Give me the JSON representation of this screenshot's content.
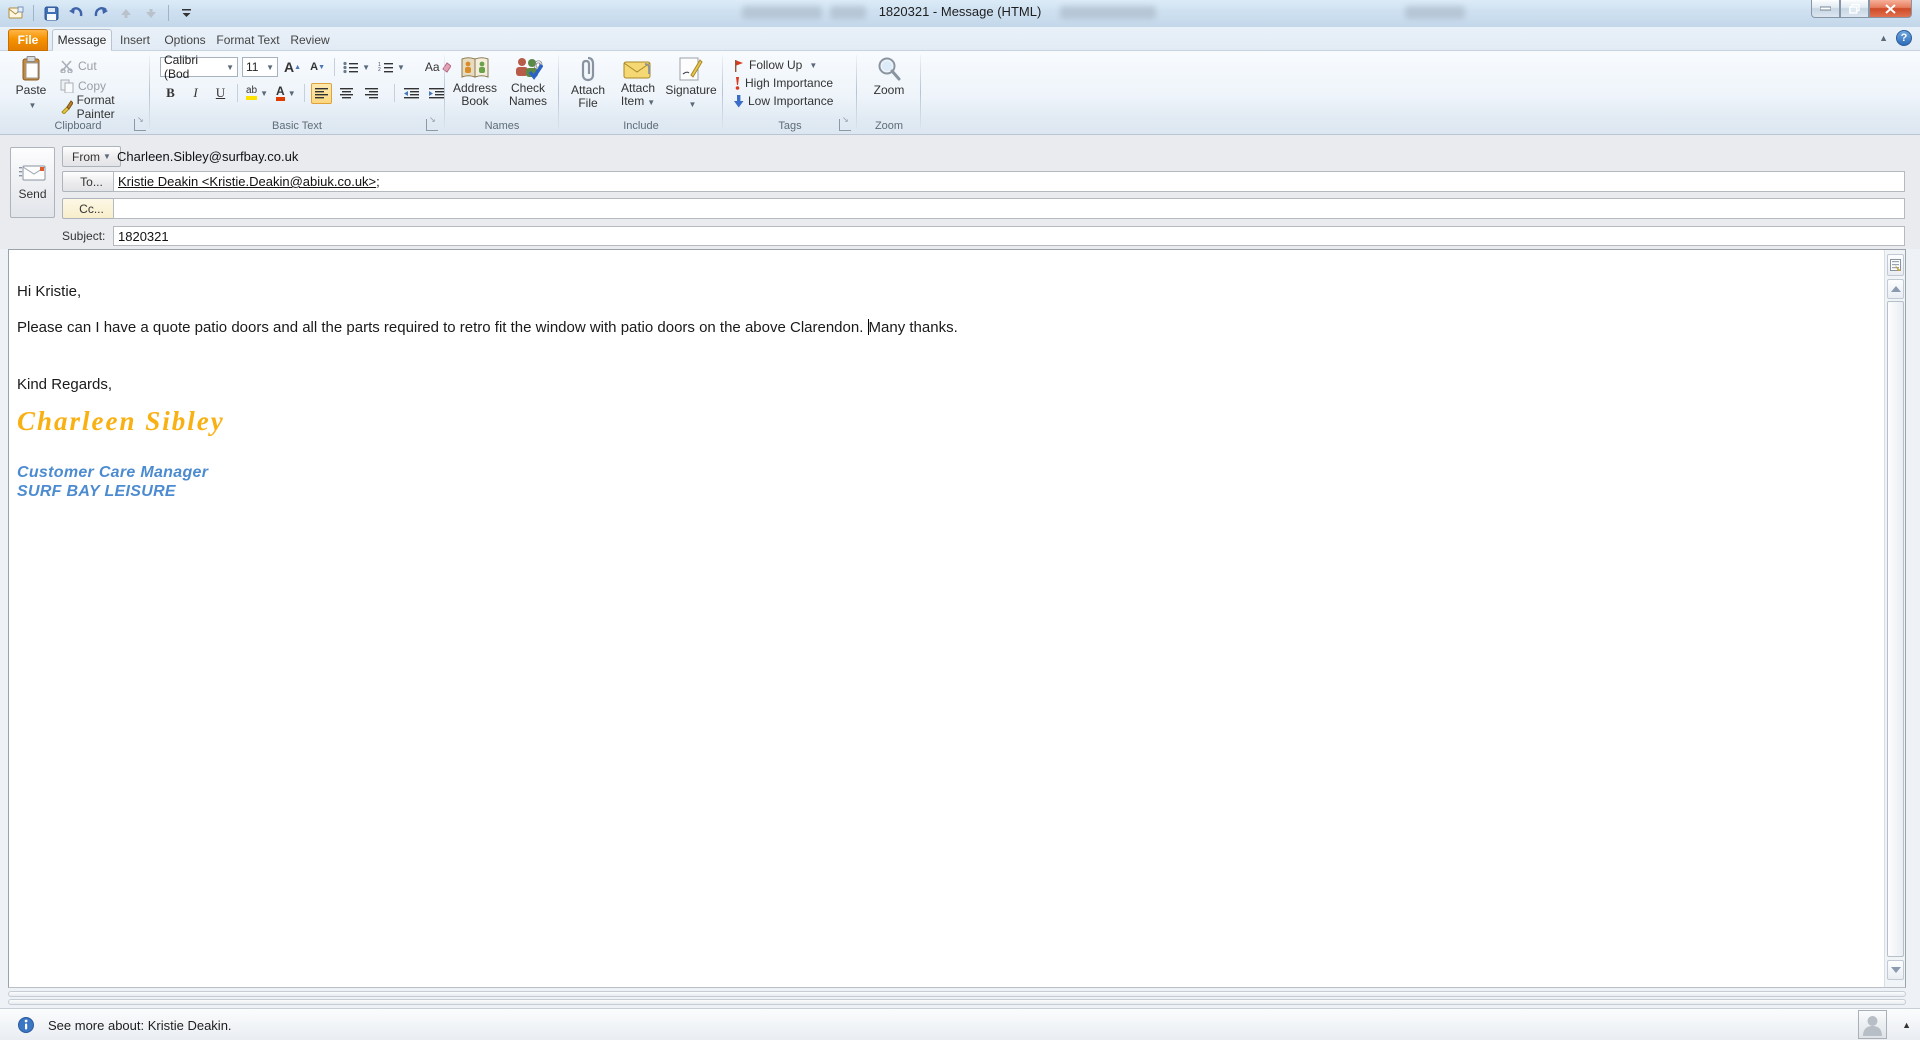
{
  "window": {
    "title": "1820321  -  Message (HTML)",
    "controls": {
      "minimize": "minimize",
      "restore": "restore",
      "close": "close"
    },
    "qat": [
      "message-item",
      "save",
      "undo",
      "redo",
      "previous-item",
      "next-item",
      "customize-quick-access"
    ]
  },
  "tabs": {
    "file": "File",
    "items": [
      {
        "label": "Message",
        "active": true
      },
      {
        "label": "Insert",
        "active": false
      },
      {
        "label": "Options",
        "active": false
      },
      {
        "label": "Format Text",
        "active": false
      },
      {
        "label": "Review",
        "active": false
      }
    ]
  },
  "ribbon": {
    "clipboard": {
      "label": "Clipboard",
      "paste": "Paste",
      "cut": "Cut",
      "copy": "Copy",
      "format_painter": "Format Painter"
    },
    "basic_text": {
      "label": "Basic Text",
      "font_name": "Calibri (Bod",
      "font_size": "11",
      "bold": "B",
      "italic": "I",
      "underline": "U",
      "clear_format": "Aa",
      "grow_font": "A",
      "shrink_font": "A",
      "highlight": "ab"
    },
    "names": {
      "label": "Names",
      "address_book_1": "Address",
      "address_book_2": "Book",
      "check_names_1": "Check",
      "check_names_2": "Names"
    },
    "include": {
      "label": "Include",
      "attach_file_1": "Attach",
      "attach_file_2": "File",
      "attach_item_1": "Attach",
      "attach_item_2": "Item",
      "signature": "Signature"
    },
    "tags": {
      "label": "Tags",
      "follow_up": "Follow Up",
      "high_importance": "High Importance",
      "low_importance": "Low Importance"
    },
    "zoom": {
      "label": "Zoom",
      "button": "Zoom"
    }
  },
  "envelope": {
    "send": "Send",
    "from_label": "From",
    "from_value": "Charleen.Sibley@surfbay.co.uk",
    "to_label": "To...",
    "to_value": "Kristie Deakin <Kristie.Deakin@abiuk.co.uk>",
    "to_suffix": ";",
    "cc_label": "Cc...",
    "cc_value": "",
    "subject_label": "Subject:",
    "subject_value": "1820321"
  },
  "body": {
    "greeting": "Hi Kristie,",
    "para_before_caret": "Please can I have a quote patio doors and all the parts required to retro fit the window with patio doors on the above Clarendon. ",
    "para_after_caret": "Many thanks.",
    "closing": "Kind Regards,",
    "signature_name": "Charleen Sibley",
    "signature_title": "Customer Care Manager",
    "signature_company": "SURF BAY LEISURE"
  },
  "people_pane": {
    "status": "See more about: Kristie Deakin."
  },
  "colors": {
    "file_tab_orange": "#F69200",
    "signature_orange": "#F9B013",
    "signature_blue": "#4C8BD0",
    "close_red": "#CF4A28",
    "active_align_yellow": "#FCD77E"
  }
}
